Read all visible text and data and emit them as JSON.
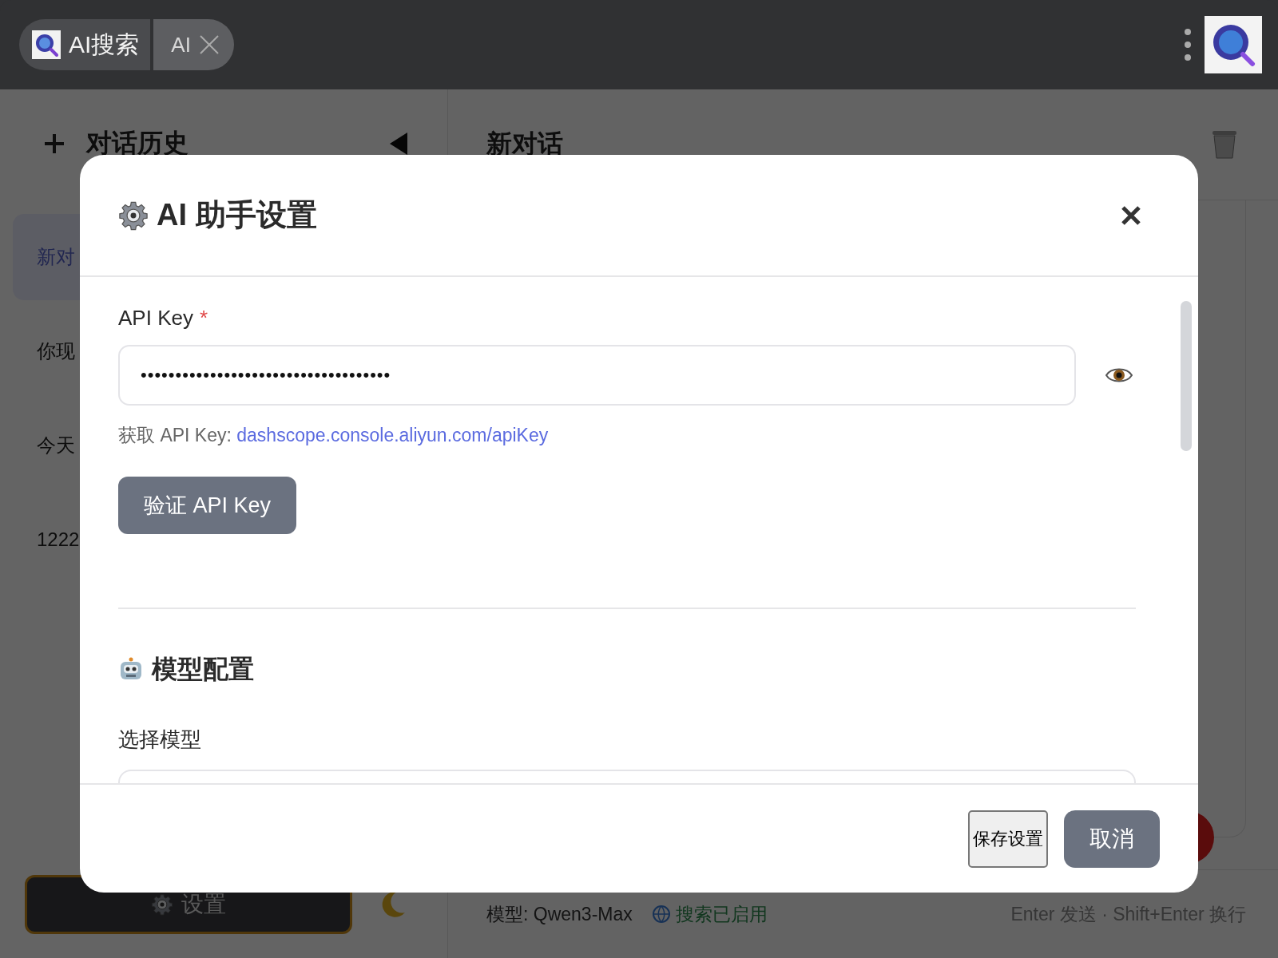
{
  "window": {
    "tabs": [
      {
        "label": "AI搜索",
        "selected": true
      },
      {
        "label": "AI",
        "selected": false
      }
    ]
  },
  "sidebar": {
    "title": "对话历史",
    "items": [
      {
        "label": "新对",
        "selected": true
      },
      {
        "label": "你现",
        "selected": false
      },
      {
        "label": "今天",
        "selected": false
      },
      {
        "label": "1222",
        "selected": false
      }
    ],
    "settings_button": "设置"
  },
  "chat": {
    "title": "新对话",
    "model": "模型: Qwen3-Max",
    "search_status": "搜索已启用",
    "hint": "Enter 发送 · Shift+Enter 换行"
  },
  "dialog": {
    "title": "AI 助手设置",
    "api_key": {
      "label": "API Key",
      "required_mark": "*",
      "value": "••••••••••••••••••••••••••••••••••••",
      "help_prefix": "获取 API Key:",
      "help_link": "dashscope.console.aliyun.com/apiKey",
      "verify_button": "验证 API Key"
    },
    "model_section": {
      "title": "模型配置",
      "select_label": "选择模型"
    },
    "buttons": [
      {
        "label": "保存设置",
        "kind": "default"
      },
      {
        "label": "取消",
        "kind": "secondary"
      }
    ]
  }
}
